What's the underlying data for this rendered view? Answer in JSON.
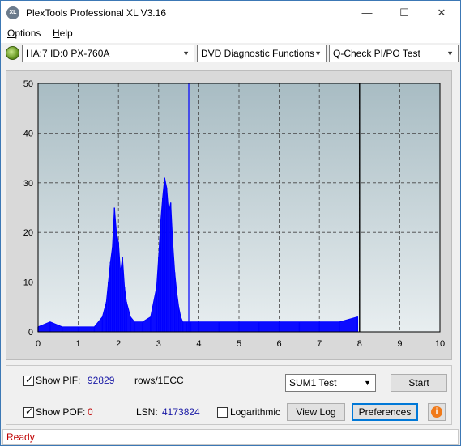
{
  "window": {
    "app_icon_text": "XL",
    "title": "PlexTools Professional XL V3.16",
    "minimize": "—",
    "maximize": "☐",
    "close": "✕"
  },
  "menu": {
    "options": "Options",
    "options_underline": "O",
    "options_rest": "ptions",
    "help": "Help",
    "help_underline": "H",
    "help_rest": "elp"
  },
  "toolbar": {
    "drive": "HA:7 ID:0  PX-760A",
    "function": "DVD Diagnostic Functions",
    "test": "Q-Check PI/PO Test",
    "arrow": "▼"
  },
  "chart_data": {
    "type": "area",
    "title": "",
    "xlabel": "",
    "ylabel": "",
    "xlim": [
      0,
      10
    ],
    "ylim": [
      0,
      50
    ],
    "x_ticks": [
      "0",
      "1",
      "2",
      "3",
      "4",
      "5",
      "6",
      "7",
      "8",
      "9",
      "10"
    ],
    "y_ticks": [
      "0",
      "10",
      "20",
      "30",
      "40",
      "50"
    ],
    "grid": true,
    "threshold_line": 4,
    "end_marker_x": 8.0,
    "spike_x": 3.75,
    "spike_y": 50,
    "series": [
      {
        "name": "PIF",
        "color": "#0000ff",
        "x": [
          0.0,
          0.3,
          0.6,
          1.0,
          1.4,
          1.6,
          1.7,
          1.75,
          1.8,
          1.85,
          1.9,
          1.95,
          2.0,
          2.05,
          2.1,
          2.15,
          2.2,
          2.3,
          2.4,
          2.6,
          2.8,
          2.95,
          3.0,
          3.05,
          3.1,
          3.15,
          3.2,
          3.25,
          3.3,
          3.35,
          3.4,
          3.45,
          3.5,
          3.55,
          3.6,
          3.7,
          3.8,
          4.0,
          4.5,
          5.0,
          5.5,
          6.0,
          6.5,
          7.0,
          7.5,
          7.95
        ],
        "values": [
          1,
          2,
          1,
          1,
          1,
          3,
          6,
          10,
          14,
          17,
          25,
          20,
          18,
          12,
          15,
          9,
          6,
          3,
          2,
          2,
          3,
          9,
          15,
          22,
          27,
          31,
          29,
          24,
          26,
          18,
          12,
          8,
          5,
          3,
          2,
          2,
          2,
          2,
          2,
          2,
          2,
          2,
          2,
          2,
          2,
          3
        ]
      },
      {
        "name": "POF",
        "color": "#00c000",
        "x": [
          0.0,
          2.0,
          4.0,
          6.0,
          8.0
        ],
        "values": [
          0,
          0,
          0,
          0,
          0
        ]
      }
    ]
  },
  "controls": {
    "show_pif_label": "Show PIF:",
    "pif_value": "92829",
    "rows_unit": "rows/1ECC",
    "show_pof_label": "Show POF:",
    "pof_value": "0",
    "lsn_label": "LSN:",
    "lsn_value": "4173824",
    "logarithmic_label": "Logarithmic",
    "test_select": "SUM1 Test",
    "start_button": "Start",
    "view_log_button": "View Log",
    "preferences_button": "Preferences",
    "info_icon_text": "i"
  },
  "status": {
    "text": "Ready"
  }
}
